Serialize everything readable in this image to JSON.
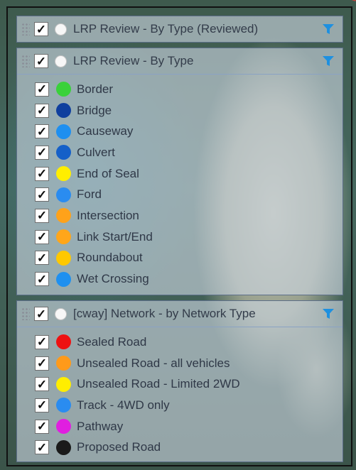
{
  "layers": [
    {
      "title": "LRP Review - By Type (Reviewed)",
      "checked": true,
      "collapsed": true,
      "items": []
    },
    {
      "title": "LRP Review - By Type",
      "checked": true,
      "collapsed": false,
      "items": [
        {
          "label": "Border",
          "color": "#3ad13a"
        },
        {
          "label": "Bridge",
          "color": "#0f3f9e"
        },
        {
          "label": "Causeway",
          "color": "#1e8ff0"
        },
        {
          "label": "Culvert",
          "color": "#1560c8"
        },
        {
          "label": "End of Seal",
          "color": "#ffee00"
        },
        {
          "label": "Ford",
          "color": "#2a8cf0"
        },
        {
          "label": "Intersection",
          "color": "#ffa21a"
        },
        {
          "label": "Link Start/End",
          "color": "#ffa61a"
        },
        {
          "label": "Roundabout",
          "color": "#ffc800"
        },
        {
          "label": "Wet Crossing",
          "color": "#1e90f0"
        }
      ]
    },
    {
      "title": "[cway] Network - by Network Type",
      "checked": true,
      "collapsed": false,
      "items": [
        {
          "label": "Sealed Road",
          "color": "#ee1111"
        },
        {
          "label": "Unsealed Road - all vehicles",
          "color": "#ff9a1a"
        },
        {
          "label": "Unsealed Road - Limited 2WD",
          "color": "#ffee00"
        },
        {
          "label": "Track - 4WD only",
          "color": "#2a8cf0"
        },
        {
          "label": "Pathway",
          "color": "#e01ee0"
        },
        {
          "label": "Proposed Road",
          "color": "#1a1a1a"
        }
      ]
    }
  ],
  "icons": {
    "check": "✓",
    "filter": "filter-icon",
    "drag": "drag-handle-icon"
  },
  "accent": "#1e90e0"
}
